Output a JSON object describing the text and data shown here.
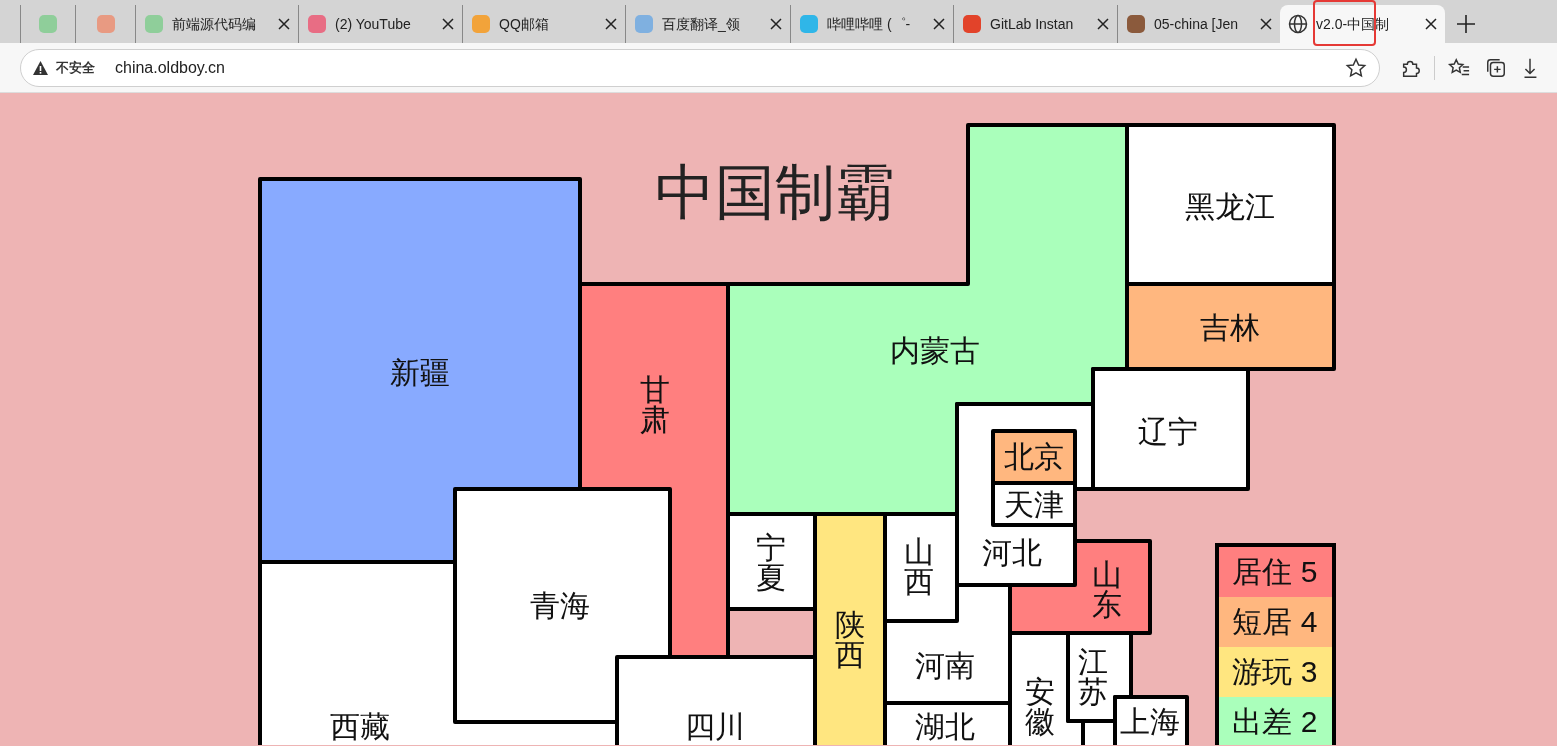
{
  "browser": {
    "tabs": [
      {
        "kind": "pinned",
        "selected": false
      },
      {
        "kind": "pinned",
        "selected": false
      },
      {
        "kind": "normal",
        "title": "前端源代码编",
        "selected": false
      },
      {
        "kind": "normal",
        "title": "(2) YouTube",
        "selected": false
      },
      {
        "kind": "normal",
        "title": "QQ邮箱",
        "selected": false
      },
      {
        "kind": "normal",
        "title": "百度翻译_领",
        "selected": false
      },
      {
        "kind": "normal",
        "title": "哔哩哔哩 (゜-",
        "selected": false
      },
      {
        "kind": "normal",
        "title": "GitLab Instan",
        "selected": false
      },
      {
        "kind": "normal",
        "title": "05-china [Jen",
        "selected": false
      },
      {
        "kind": "normal",
        "title": "v2.0-中国制",
        "selected": true,
        "highlighted": true
      }
    ],
    "address_bar": {
      "security": "不安全",
      "url": "china.oldboy.cn"
    }
  },
  "page": {
    "title": "中国制霸",
    "provinces": [
      {
        "name": "新疆",
        "color": "#88aaff",
        "kind": "horizontal"
      },
      {
        "name": "西藏",
        "color": "#ffffff",
        "kind": "horizontal"
      },
      {
        "name": "甘肃",
        "color": "#ff7f7f",
        "kind": "vertical"
      },
      {
        "name": "青海",
        "color": "#ffffff",
        "kind": "horizontal"
      },
      {
        "name": "四川",
        "color": "#ffffff",
        "kind": "horizontal"
      },
      {
        "name": "内蒙古",
        "color": "#aaffbb",
        "kind": "horizontal"
      },
      {
        "name": "黑龙江",
        "color": "#ffffff",
        "kind": "horizontal"
      },
      {
        "name": "吉林",
        "color": "#ffb77f",
        "kind": "horizontal"
      },
      {
        "name": "辽宁",
        "color": "#ffffff",
        "kind": "horizontal"
      },
      {
        "name": "河北",
        "color": "#ffffff",
        "kind": "horizontal"
      },
      {
        "name": "北京",
        "color": "#ffb77f",
        "kind": "horizontal"
      },
      {
        "name": "天津",
        "color": "#ffffff",
        "kind": "horizontal"
      },
      {
        "name": "宁夏",
        "color": "#ffffff",
        "kind": "vertical"
      },
      {
        "name": "陕西",
        "color": "#ffe680",
        "kind": "vertical"
      },
      {
        "name": "山西",
        "color": "#ffffff",
        "kind": "vertical"
      },
      {
        "name": "河南",
        "color": "#ffffff",
        "kind": "horizontal"
      },
      {
        "name": "山东",
        "color": "#ff7f7f",
        "kind": "vertical"
      },
      {
        "name": "安徽",
        "color": "#ffffff",
        "kind": "vertical"
      },
      {
        "name": "江苏",
        "color": "#ffffff",
        "kind": "vertical"
      },
      {
        "name": "湖北",
        "color": "#ffffff",
        "kind": "horizontal"
      },
      {
        "name": "上海",
        "color": "#ffffff",
        "kind": "horizontal"
      },
      {
        "color": "#ffffff"
      }
    ],
    "legend": [
      {
        "label": "居住 5",
        "color": "#ff7f7f"
      },
      {
        "label": "短居 4",
        "color": "#ffb77f"
      },
      {
        "label": "游玩 3",
        "color": "#ffe680"
      },
      {
        "label": "出差 2",
        "color": "#aaffbb"
      }
    ]
  }
}
